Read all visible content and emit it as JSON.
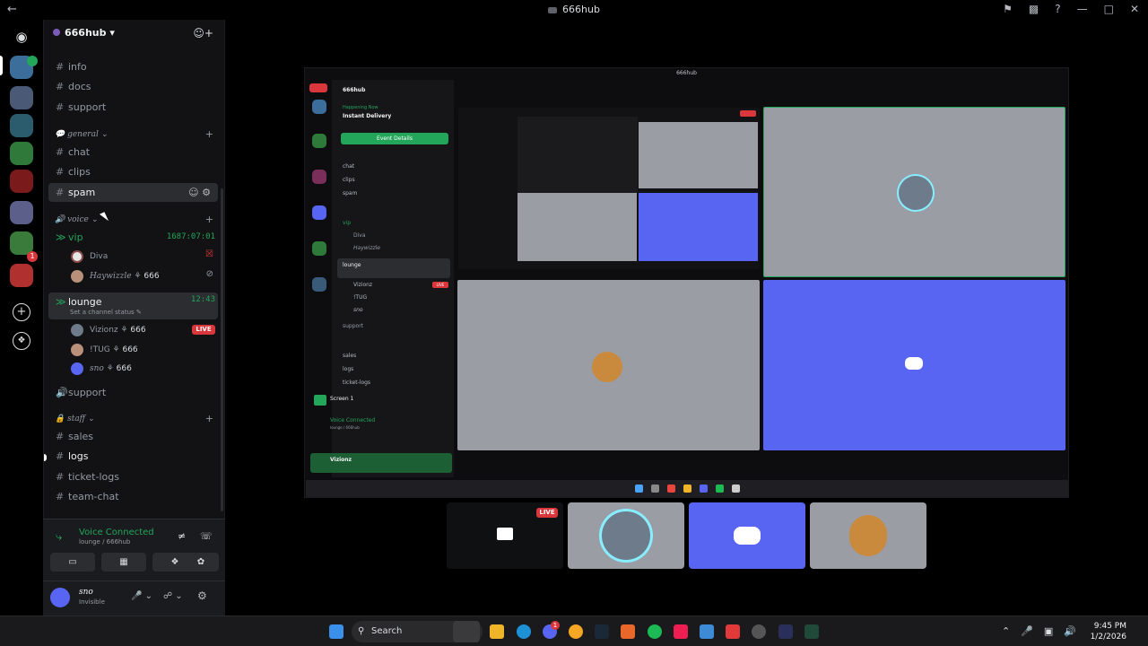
{
  "window": {
    "title": "666hub"
  },
  "server": {
    "name": "666hub"
  },
  "channels": {
    "info": "info",
    "docs": "docs",
    "support": "support",
    "chat": "chat",
    "clips": "clips",
    "spam": "spam",
    "sales": "sales",
    "logs": "logs",
    "ticket_logs": "ticket-logs",
    "team_chat": "team-chat",
    "voice_support": "support"
  },
  "categories": {
    "general": "general",
    "voice": "voice",
    "staff": "staff"
  },
  "voice_channels": [
    {
      "name": "vip",
      "timer": "1687:07:01",
      "users": [
        {
          "name": "Diva"
        },
        {
          "name": "Haywizzle",
          "tag": "666"
        }
      ]
    },
    {
      "name": "lounge",
      "timer": "12:43",
      "status_placeholder": "Set a channel status",
      "users": [
        {
          "name": "Vizionz",
          "tag": "666",
          "live": "LIVE"
        },
        {
          "name": "!TUG",
          "tag": "666"
        },
        {
          "name": "sno",
          "tag": "666"
        }
      ]
    }
  ],
  "voice_panel": {
    "status": "Voice Connected",
    "location": "lounge / 666hub"
  },
  "me": {
    "name": "sno",
    "status": "Invisible"
  },
  "stream": {
    "inner_title": "666hub",
    "inner_channels": [
      "chat",
      "clips",
      "spam",
      "vip",
      "Diva",
      "Haywizzle",
      "lounge",
      "Vizionz",
      "!TUG",
      "sno",
      "support",
      "sales",
      "logs",
      "ticket-logs"
    ],
    "event_button": "Event Details",
    "happening_now": "Happening Now",
    "instant_delivery": "Instant Delivery",
    "screen": "Screen 1",
    "voice_connected": "Voice Connected",
    "voice_location": "lounge / 666hub",
    "inner_user": "Vizionz",
    "inner_live": "LIVE"
  },
  "thumbs": {
    "live": "LIVE"
  },
  "taskbar": {
    "search": "Search",
    "time": "9:45 PM",
    "date": "1/2/2026",
    "mail_badge": "1"
  },
  "rail": {
    "badge1": "1",
    "badge2": "1"
  },
  "colors": {
    "accent_green": "#23a55a",
    "blurple": "#5865f2",
    "tile_gray": "#9b9da4",
    "live_red": "#da373c"
  }
}
